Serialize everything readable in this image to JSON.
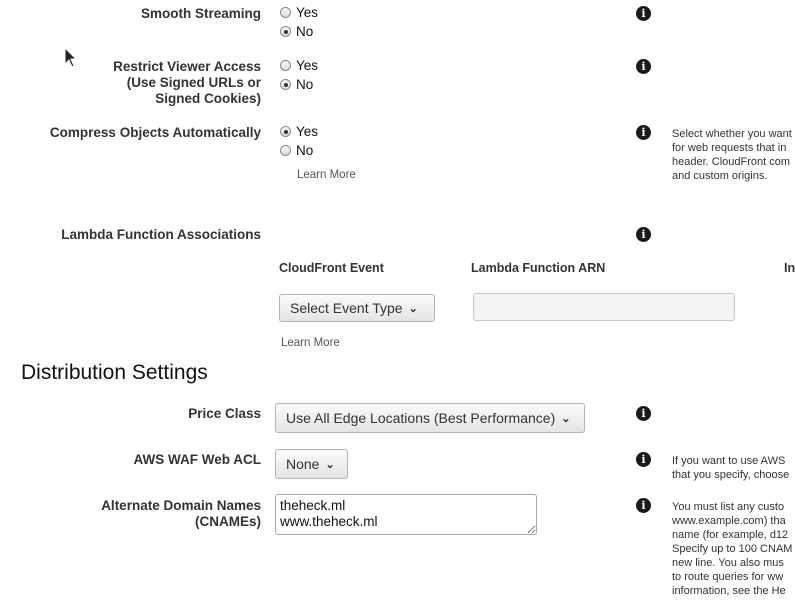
{
  "smooth_streaming": {
    "label": "Smooth Streaming",
    "options": [
      "Yes",
      "No"
    ]
  },
  "restrict_viewer": {
    "label_lines": [
      "Restrict Viewer Access",
      "(Use Signed URLs or",
      "Signed Cookies)"
    ],
    "options": [
      "Yes",
      "No"
    ]
  },
  "compress": {
    "label": "Compress Objects Automatically",
    "options": [
      "Yes",
      "No"
    ],
    "learn_more": "Learn More",
    "help_lines": [
      "Select whether you want",
      "for web requests that in",
      "header. CloudFront com",
      "and custom origins."
    ]
  },
  "lambda": {
    "label": "Lambda Function Associations",
    "col_event": "CloudFront Event",
    "col_arn": "Lambda Function ARN",
    "col_include": "In",
    "event_select": "Select Event Type",
    "learn_more": "Learn More"
  },
  "section_title": "Distribution Settings",
  "price_class": {
    "label": "Price Class",
    "value": "Use All Edge Locations (Best Performance)"
  },
  "waf": {
    "label": "AWS WAF Web ACL",
    "value": "None",
    "help_lines": [
      "If you want to use AWS",
      "that you specify, choose"
    ]
  },
  "cnames": {
    "label_lines": [
      "Alternate Domain Names",
      "(CNAMEs)"
    ],
    "value": "theheck.ml\nwww.theheck.ml",
    "help_lines": [
      "You must list any custo",
      "www.example.com) tha",
      "name (for example, d12",
      "Specify up to 100 CNAM",
      "new line. You also mus",
      "to route queries for ww",
      "information, see the He"
    ]
  }
}
